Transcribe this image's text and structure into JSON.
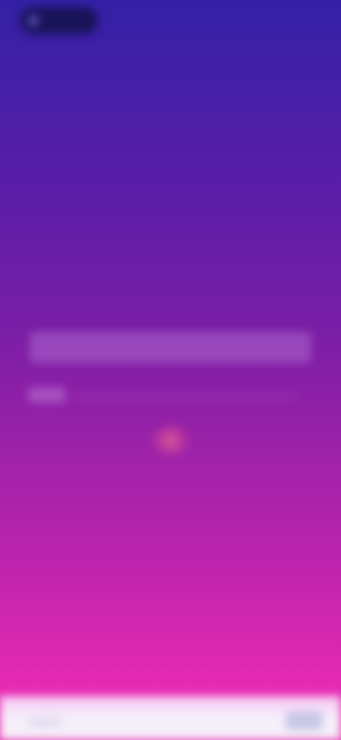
{
  "screen": {
    "state": "blurred",
    "gradient_colors": [
      "#3320a6",
      "#5a1ea8",
      "#9b22a8",
      "#e52ab2",
      "#f02eb6"
    ],
    "accent_colors": {
      "pill": "#14124a",
      "orb": "#d85a9a",
      "bottom_bar": "#f4f1f8"
    }
  },
  "top_pill": {
    "icon": "status-dot-icon",
    "label": ""
  },
  "input_bar": {
    "placeholder": ""
  },
  "small_label": {
    "text": ""
  },
  "center_orb": {
    "icon": "loading-orb-icon"
  },
  "bottom_bar": {
    "left_label": "",
    "right_button_label": ""
  }
}
